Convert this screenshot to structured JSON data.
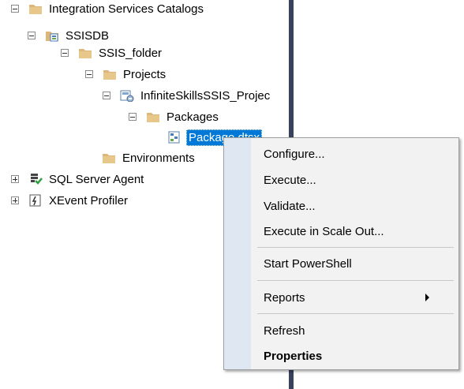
{
  "tree": {
    "integration_services_catalogs": "Integration Services Catalogs",
    "ssisdb": "SSISDB",
    "ssis_folder": "SSIS_folder",
    "projects": "Projects",
    "project": "InfiniteSkillsSSIS_Projec",
    "packages": "Packages",
    "package": "Package.dtsx",
    "environments": "Environments",
    "sql_server_agent": "SQL Server Agent",
    "xevent_profiler": "XEvent Profiler"
  },
  "context_menu": {
    "configure": "Configure...",
    "execute": "Execute...",
    "validate": "Validate...",
    "execute_scale_out": "Execute in Scale Out...",
    "start_powershell": "Start PowerShell",
    "reports": "Reports",
    "refresh": "Refresh",
    "properties": "Properties"
  },
  "colors": {
    "selection": "#0078d7",
    "folder": "#dcb67a",
    "splitter": "#38425c",
    "menu_background": "#f2f2f2"
  }
}
